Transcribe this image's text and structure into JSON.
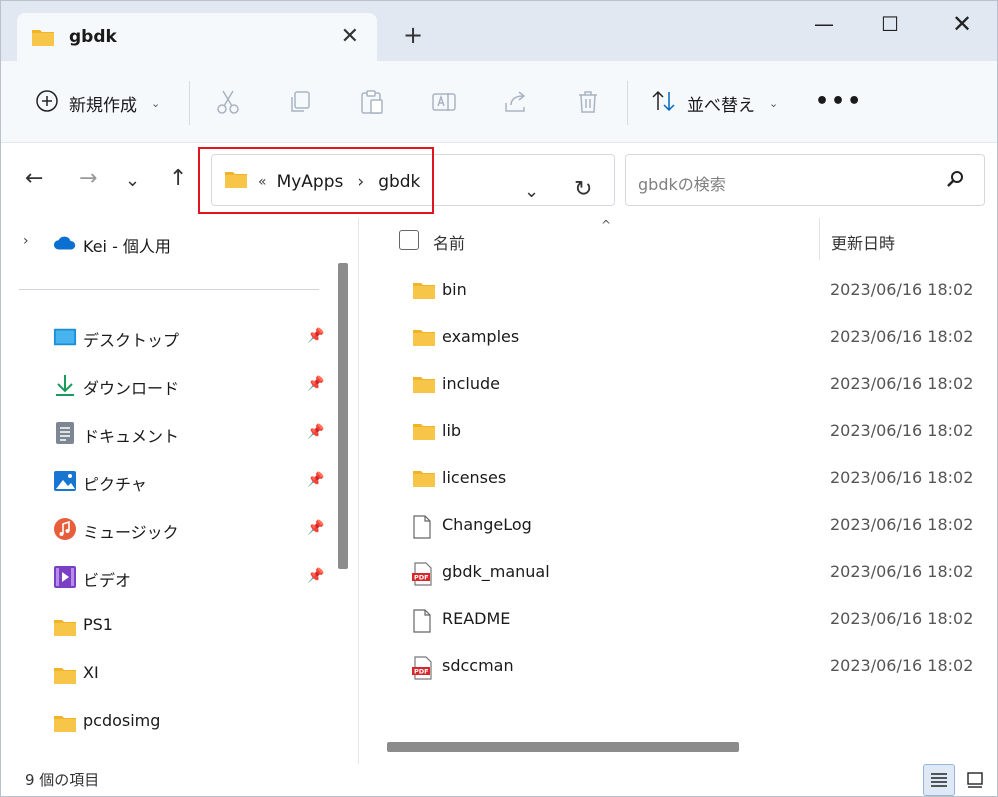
{
  "tab": {
    "title": "gbdk",
    "close": "✕",
    "new": "+"
  },
  "window_controls": {
    "minimize": "—",
    "maximize": "☐",
    "close": "✕"
  },
  "command_bar": {
    "new_label": "新規作成",
    "sort_label": "並べ替え",
    "more": "•••"
  },
  "address": {
    "overflow": "«",
    "segments": [
      "MyApps",
      "gbdk"
    ],
    "separator": "›"
  },
  "search": {
    "placeholder": "gbdkの検索"
  },
  "sidebar": {
    "onedrive": "Kei - 個人用",
    "items": [
      {
        "label": "デスクトップ",
        "icon": "desktop-icon",
        "pinned": true
      },
      {
        "label": "ダウンロード",
        "icon": "download-icon",
        "pinned": true
      },
      {
        "label": "ドキュメント",
        "icon": "document-icon",
        "pinned": true
      },
      {
        "label": "ピクチャ",
        "icon": "pictures-icon",
        "pinned": true
      },
      {
        "label": "ミュージック",
        "icon": "music-icon",
        "pinned": true
      },
      {
        "label": "ビデオ",
        "icon": "video-icon",
        "pinned": true
      },
      {
        "label": "PS1",
        "icon": "folder-icon",
        "pinned": false
      },
      {
        "label": "XI",
        "icon": "folder-icon",
        "pinned": false
      },
      {
        "label": "pcdosimg",
        "icon": "folder-icon",
        "pinned": false
      }
    ]
  },
  "file_list": {
    "columns": {
      "name": "名前",
      "date": "更新日時"
    },
    "rows": [
      {
        "name": "bin",
        "date": "2023/06/16 18:02",
        "type": "folder"
      },
      {
        "name": "examples",
        "date": "2023/06/16 18:02",
        "type": "folder"
      },
      {
        "name": "include",
        "date": "2023/06/16 18:02",
        "type": "folder"
      },
      {
        "name": "lib",
        "date": "2023/06/16 18:02",
        "type": "folder"
      },
      {
        "name": "licenses",
        "date": "2023/06/16 18:02",
        "type": "folder"
      },
      {
        "name": "ChangeLog",
        "date": "2023/06/16 18:02",
        "type": "file"
      },
      {
        "name": "gbdk_manual",
        "date": "2023/06/16 18:02",
        "type": "pdf"
      },
      {
        "name": "README",
        "date": "2023/06/16 18:02",
        "type": "file"
      },
      {
        "name": "sdccman",
        "date": "2023/06/16 18:02",
        "type": "pdf"
      }
    ]
  },
  "status": {
    "item_count": "9 個の項目"
  },
  "colors": {
    "folder": "#f7c648",
    "accent": "#0067c0",
    "highlight": "#e0141e",
    "pdf": "#d9262b"
  }
}
